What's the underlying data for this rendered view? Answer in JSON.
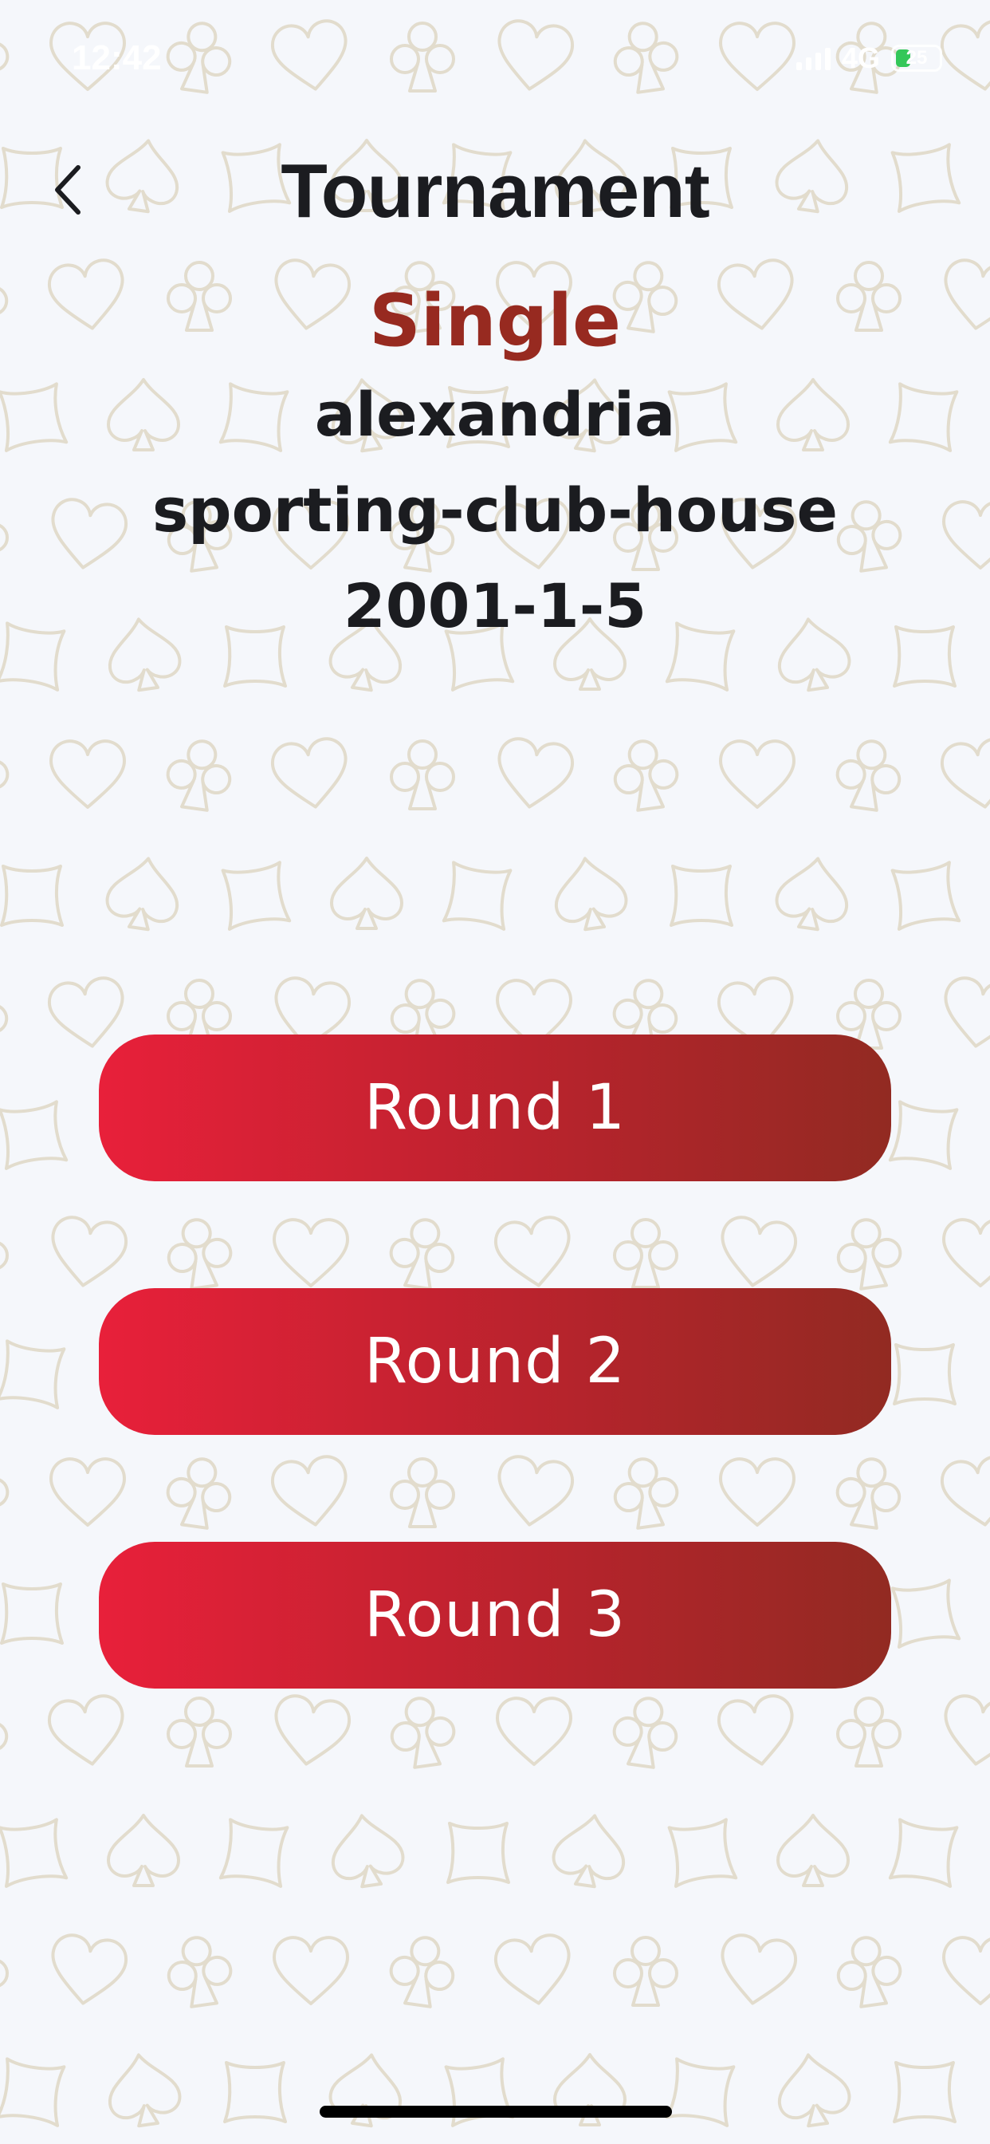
{
  "status_bar": {
    "time": "12:42",
    "network": "4G",
    "battery": "25"
  },
  "header": {
    "title": "Tournament"
  },
  "tournament": {
    "type": "Single",
    "location_line1": "alexandria",
    "location_line2": "sporting-club-house",
    "date": "2001-1-5"
  },
  "rounds": [
    {
      "label": "Round 1"
    },
    {
      "label": "Round 2"
    },
    {
      "label": "Round 3"
    }
  ],
  "icons": {
    "back": "chevron-left-icon",
    "background": "card-suit-pattern"
  },
  "colors": {
    "background": "#f5f7fb",
    "pattern_stroke": "#e2dccd",
    "accent_red": "#972a20",
    "button_gradient_start": "#e8203a",
    "button_gradient_end": "#922a22",
    "title_text": "#1b1c20",
    "battery_green": "#34c759"
  }
}
